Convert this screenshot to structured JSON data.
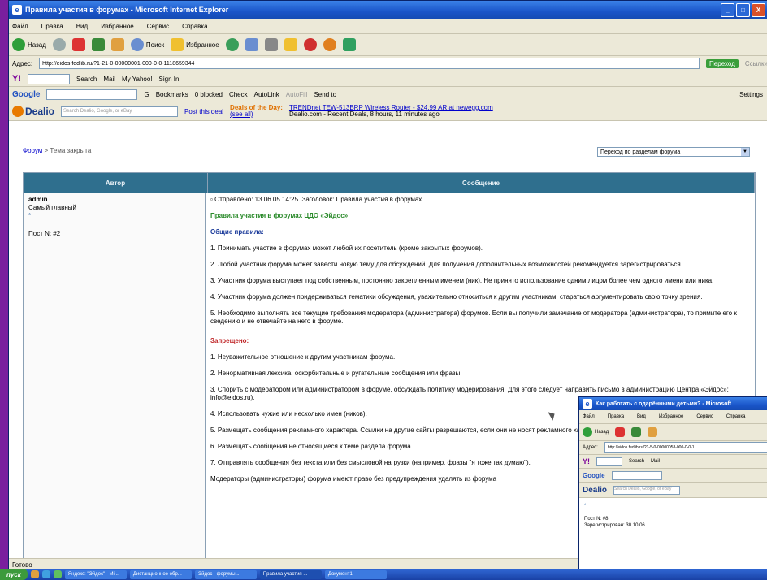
{
  "window": {
    "title": "Правила участия в форумах - Microsoft Internet Explorer",
    "controls": [
      "_",
      "□",
      "X"
    ]
  },
  "menu": [
    "Файл",
    "Правка",
    "Вид",
    "Избранное",
    "Сервис",
    "Справка"
  ],
  "toolbar": {
    "back": "Назад",
    "search": "Поиск",
    "favorites": "Избранное"
  },
  "address": {
    "label": "Адрес:",
    "url": "http://eidos.fedlib.ru/?1-21-0-00000001-000-0-0-1118659344",
    "go": "Переход",
    "links": "Ссылки"
  },
  "yahoo": {
    "logo": "Y!",
    "search": "Search",
    "mail": "Mail",
    "my_yahoo": "My Yahoo!",
    "sign_in": "Sign In"
  },
  "google": {
    "logo": "Google",
    "go": "G",
    "bookmarks": "Bookmarks",
    "blocked": "0 blocked",
    "check": "Check",
    "autolink": "AutoLink",
    "autofill": "AutoFill",
    "send_to": "Send to",
    "settings": "Settings"
  },
  "dealio": {
    "logo": "Dealio",
    "search_placeholder": "Search Dealio, Google, or eBay",
    "post_deal": "Post this deal",
    "deal_label": "Deals of the Day:",
    "see_all": "(see all)",
    "deal_link": "TRENDnet TEW-513BRP Wireless Router - $24.99 AR at newegg.com",
    "deal_source": "Dealio.com - Recent Deals, 8 hours, 11 minutes ago"
  },
  "breadcrumb": {
    "link": "Форум",
    "rest": " > Тема закрыта"
  },
  "jump_menu": "Переход по разделам форума",
  "table": {
    "headers": [
      "Автор",
      "Сообщение"
    ],
    "author": {
      "name": "admin",
      "rank": "Самый главный",
      "star": "*",
      "post_number": "Пост N: #2"
    },
    "message": {
      "meta": "Отправлено: 13.06.05 14:25. Заголовок: Правила участия в форумах",
      "title": "Правила участия в форумах ЦДО «Эйдос»",
      "general_heading": "Общие правила:",
      "general": [
        "1. Принимать участие в форумах может любой их посетитель (кроме закрытых форумов).",
        "2. Любой участник форума может завести новую тему для обсуждений. Для получения дополнительных возможностей рекомендуется зарегистрироваться.",
        "3. Участник форума выступает под собственным, постоянно закрепленным именем (ник). Не принято использование одним лицом более чем одного имени или ника.",
        "4. Участник форума должен придерживаться тематики обсуждения, уважительно относиться к другим участникам, стараться аргументировать свою точку зрения.",
        "5. Необходимо выполнять все текущие требования модератора (администратора) форумов. Если вы получили замечание от модератора (администратора), то примите его к сведению и не отвечайте на него в форуме."
      ],
      "forbidden_heading": "Запрещено:",
      "forbidden": [
        "1. Неуважительное отношение к другим участникам форума.",
        "2. Ненормативная лексика, оскорбительные и ругательные сообщения или фразы.",
        "3. Спорить с модератором или администратором в форуме, обсуждать политику модерирования. Для этого следует направить письмо в администрацию Центра «Эйдос»: info@eidos.ru).",
        "4. Использовать чужие или несколько имен (ников).",
        "5. Размещать сообщения рекламного характера. Ссылки на другие сайты разрешаются, если они не носят рекламного характера.",
        "6. Размещать сообщения не относящиеся к теме раздела форума.",
        "7. Отправлять сообщения без текста или без смысловой нагрузки (например, фразы \"я тоже так думаю\")."
      ],
      "footer": "Модераторы (администраторы) форума имеют право без предупреждения удалять из форума"
    }
  },
  "status": "Готово",
  "taskbar": {
    "start": "пуск",
    "tasks": [
      "Яндекс: \"Эйдос\" - Mi...",
      "Дистанционное обр...",
      "Эйдос - форумы ...",
      "Правила участия ...",
      "Документ1"
    ]
  },
  "second_window": {
    "title": "Как работать с одарёнными детьми? - Microsoft",
    "menu": [
      "Файл",
      "Правка",
      "Вид",
      "Избранное",
      "Сервис",
      "Справка"
    ],
    "address": "http://eidos.fedlib.ru/?1-5-0-00000058-000-0-0-1",
    "post_number": "Пост N: #8",
    "registered": "Зарегистрирован: 30.10.06"
  }
}
